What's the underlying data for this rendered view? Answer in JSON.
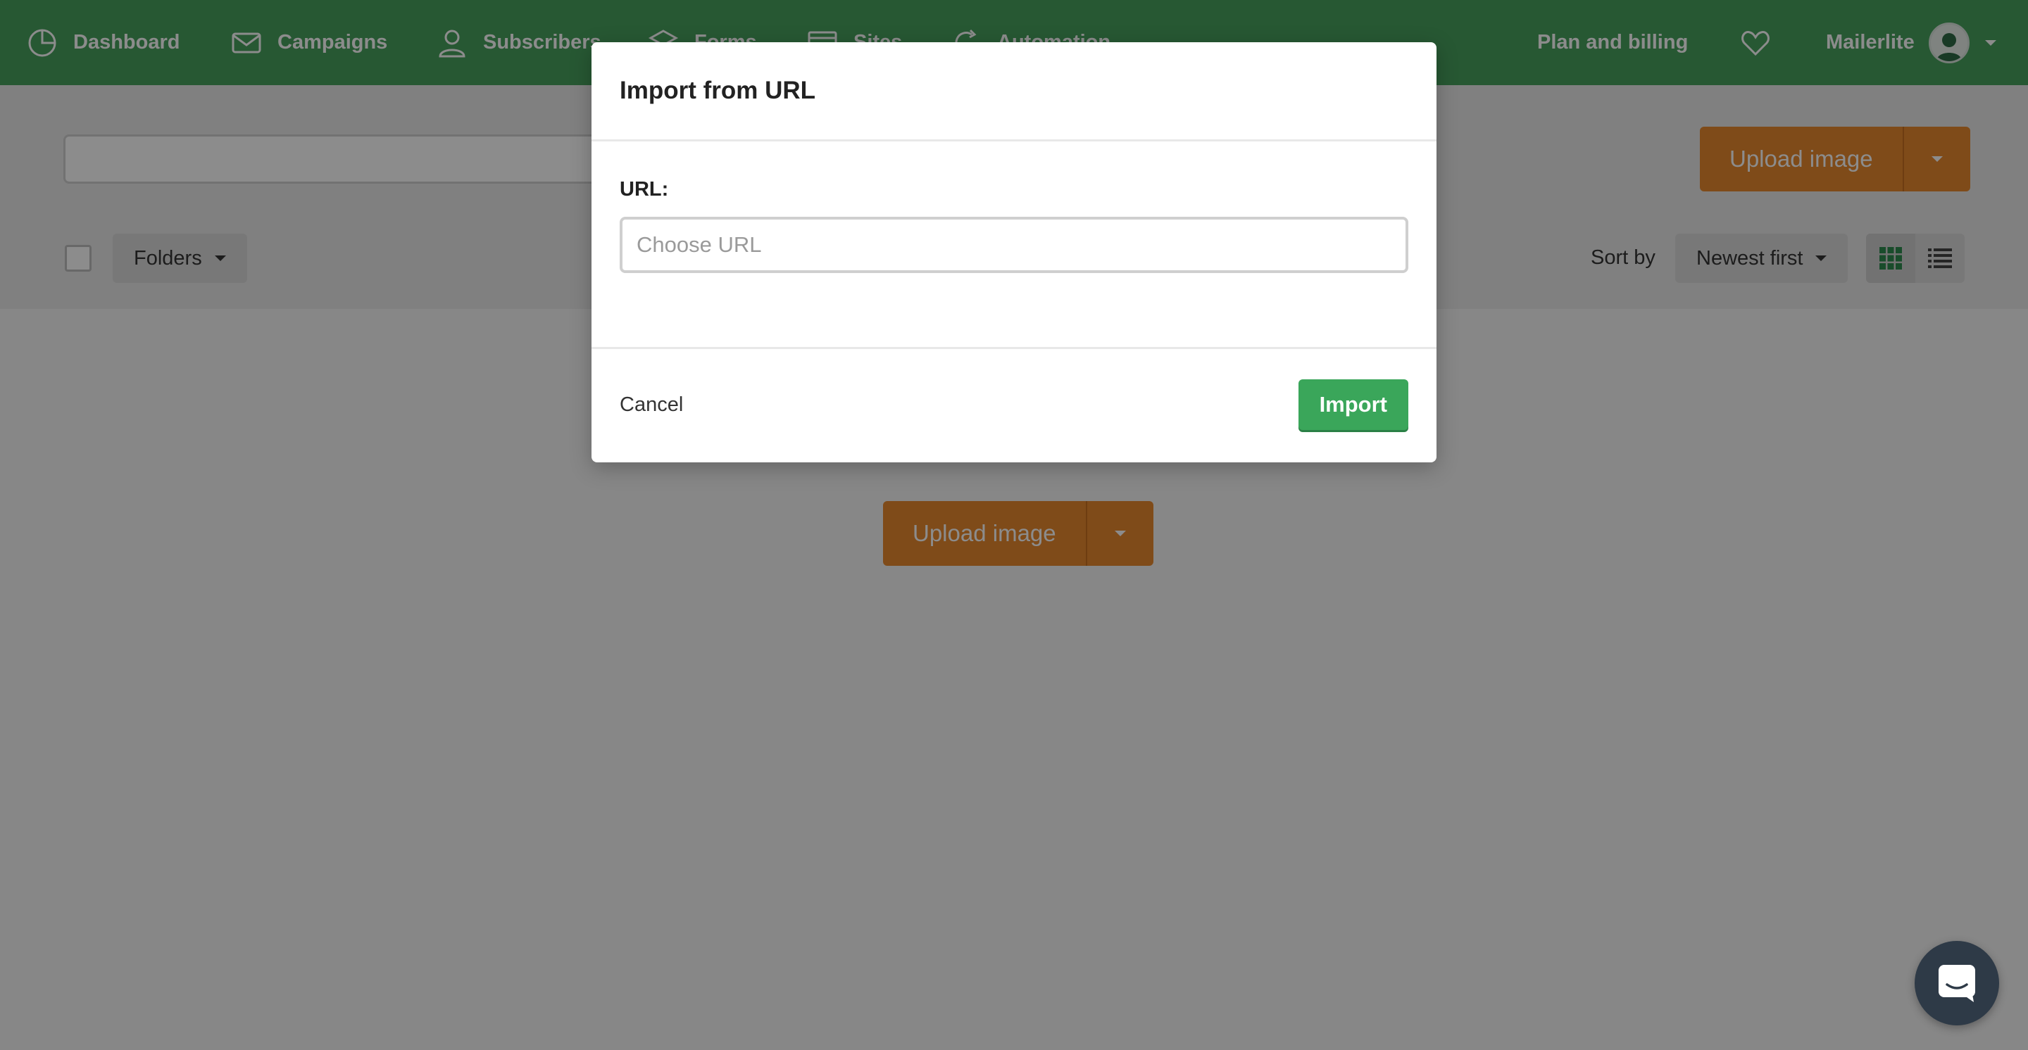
{
  "nav": {
    "items": [
      {
        "label": "Dashboard",
        "icon": "dashboard-icon"
      },
      {
        "label": "Campaigns",
        "icon": "mail-icon"
      },
      {
        "label": "Subscribers",
        "icon": "user-icon"
      },
      {
        "label": "Forms",
        "icon": "layers-icon"
      },
      {
        "label": "Sites",
        "icon": "browser-icon"
      },
      {
        "label": "Automation",
        "icon": "refresh-icon"
      }
    ],
    "plan_billing": "Plan and billing",
    "account_name": "Mailerlite"
  },
  "toolbar": {
    "upload_label": "Upload image",
    "folders_label": "Folders",
    "sort_by_label": "Sort by",
    "sort_value": "Newest first"
  },
  "empty_state": {
    "upload_label": "Upload image"
  },
  "modal": {
    "title": "Import from URL",
    "url_label": "URL:",
    "url_placeholder": "Choose URL",
    "url_value": "",
    "cancel_label": "Cancel",
    "import_label": "Import"
  },
  "colors": {
    "nav_green": "#47a05e",
    "upload_orange": "#e8892f",
    "import_green": "#3aa65a"
  }
}
